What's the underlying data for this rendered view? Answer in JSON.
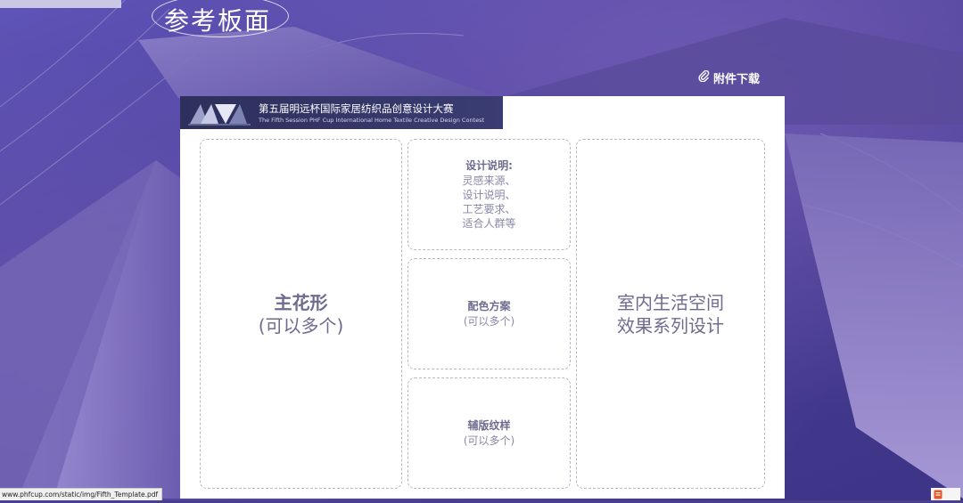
{
  "page": {
    "title": "参考板面",
    "download_label": "附件下载"
  },
  "banner": {
    "logo": "MV",
    "title_cn": "第五届明远杯国际家居纺织品创意设计大赛",
    "title_en": "The Fifth Session PHF Cup International Home Textile Creative Design Contest"
  },
  "template": {
    "main_pattern": {
      "title": "主花形",
      "note": "(可以多个)"
    },
    "design_notes": {
      "title": "设计说明:",
      "lines": [
        "灵感来源、",
        "设计说明、",
        "工艺要求、",
        "适合人群等"
      ]
    },
    "color_scheme": {
      "title": "配色方案",
      "note": "(可以多个)"
    },
    "aux_pattern": {
      "title": "辅版纹样",
      "note": "(可以多个)"
    },
    "interior_effect": {
      "lines": [
        "室内生活空间",
        "效果系列设计"
      ]
    }
  },
  "status_bar": {
    "url": "www.phfcup.com/static/img/Fifth_Template.pdf"
  },
  "colors": {
    "background": "#4a3f8f",
    "banner": "#2d2f5c",
    "box_text": "#6e6b8f",
    "dash_border": "#b8b8c4"
  }
}
